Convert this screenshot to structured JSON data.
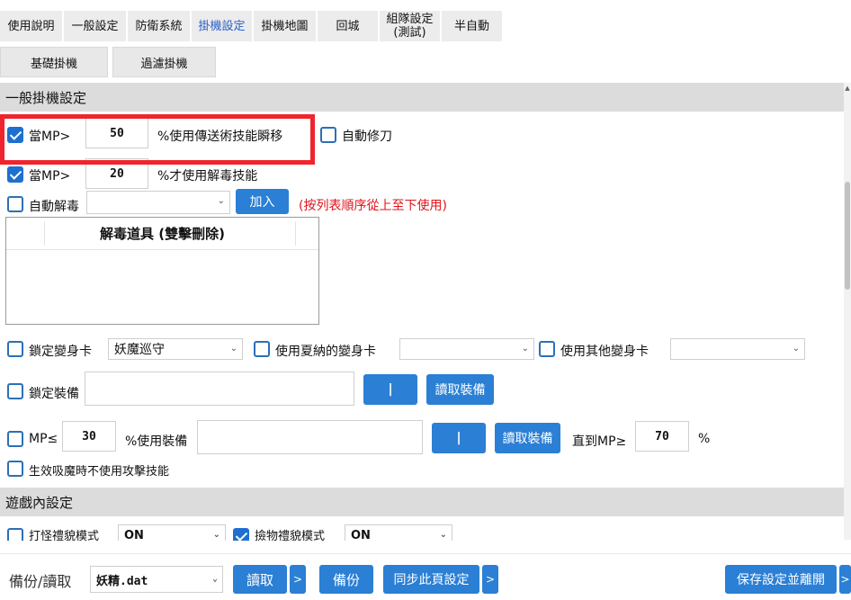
{
  "tabs": {
    "help": "使用說明",
    "general": "一般設定",
    "defense": "防衛系統",
    "afk": "掛機設定",
    "afk_map": "掛機地圖",
    "return_city": "回城",
    "party_line1": "組隊設定",
    "party_line2": "(測試)",
    "semi_auto": "半自動"
  },
  "subtabs": {
    "basic": "基礎掛機",
    "filter": "過濾掛機"
  },
  "section_general": "一般掛機設定",
  "row1": {
    "label": "當MP>",
    "value": "50",
    "suffix": "%使用傳送術技能瞬移",
    "checked": true,
    "auto_repair": "自動修刀",
    "auto_repair_checked": false
  },
  "row2": {
    "label": "當MP>",
    "value": "20",
    "suffix": "%才使用解毒技能",
    "checked": true
  },
  "row3": {
    "label": "自動解毒",
    "select": "",
    "add_button": "加入",
    "note": "(按列表順序從上至下使用)",
    "checked": false
  },
  "antidote_list": {
    "header": "解毒道具 (雙擊刪除)"
  },
  "row_transform": {
    "lock_label": "鎖定變身卡",
    "lock_value": "妖魔巡守",
    "charna_label": "使用夏納的變身卡",
    "charna_value": "",
    "other_label": "使用其他變身卡",
    "other_value": ""
  },
  "row_equip": {
    "label": "鎖定裝備",
    "pipe_button": "|",
    "read_button": "讀取裝備"
  },
  "row_mp_equip": {
    "label": "MP≤",
    "value": "30",
    "suffix": "%使用裝備",
    "pipe_button": "|",
    "read_button": "讀取裝備",
    "until_label": "直到MP≥",
    "until_value": "70",
    "percent": "%"
  },
  "row_noattack": {
    "label": "生效吸魔時不使用攻擊技能"
  },
  "section_game": "遊戲內設定",
  "row_game": {
    "attack_label": "打怪禮貌模式",
    "attack_value": "ON",
    "pickup_label": "撿物禮貌模式",
    "pickup_value": "ON",
    "pickup_checked": true
  },
  "bottom": {
    "backup_label": "備份/讀取",
    "file": "妖精.dat",
    "read": "讀取",
    "arrow": ">",
    "backup": "備份",
    "sync": "同步此頁設定",
    "save_leave": "保存設定並離開"
  },
  "colors": {
    "accent": "#2b7fd4",
    "highlight_box": "#f0242c",
    "note_red": "#e0141b",
    "active_tab": "#2a5fc7"
  }
}
